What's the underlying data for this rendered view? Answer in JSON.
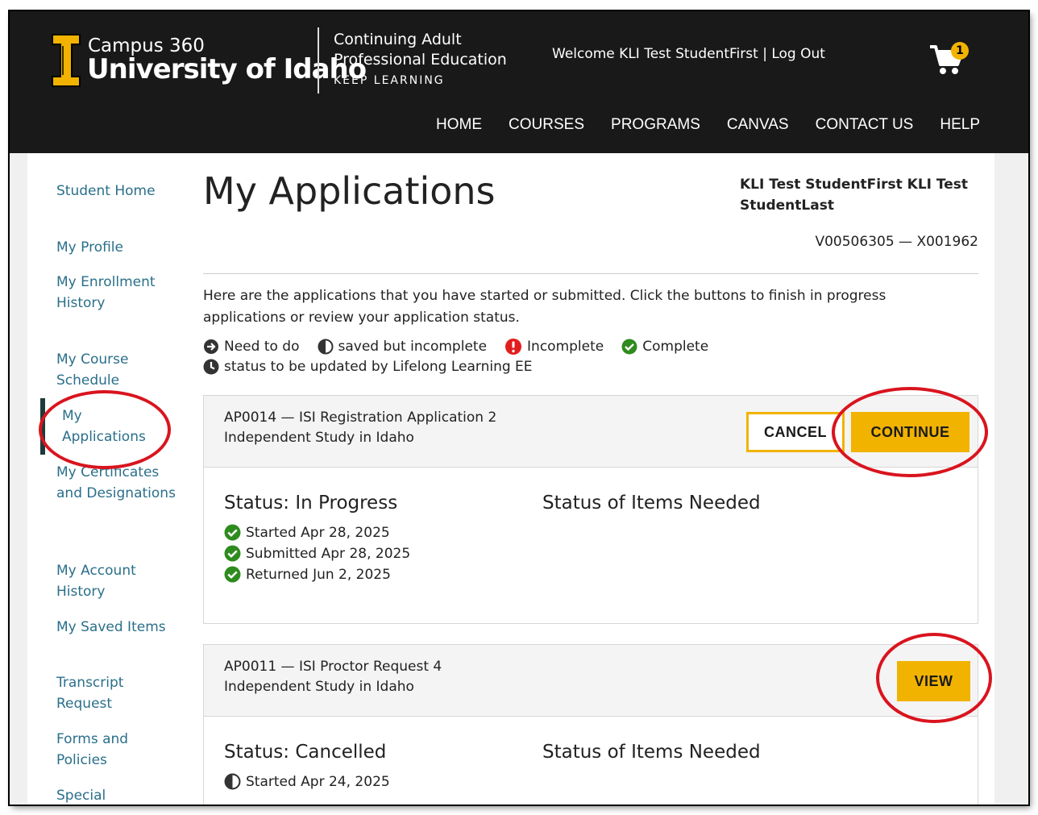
{
  "header": {
    "logo_campus": "Campus 360",
    "logo_university": "University of Idaho",
    "cape_line1": "Continuing Adult",
    "cape_line2": "Professional Education",
    "cape_line3": "KEEP LEARNING",
    "welcome": "Welcome KLI Test StudentFirst",
    "separator": "|",
    "logout": "Log Out",
    "cart_count": "1",
    "cart_icon": "shopping-cart-icon"
  },
  "nav": [
    "HOME",
    "COURSES",
    "PROGRAMS",
    "CANVAS",
    "CONTACT US",
    "HELP"
  ],
  "sidebar": {
    "items": [
      "Student Home",
      "My Profile",
      "My Enrollment History",
      "My Course Schedule",
      "My Applications",
      "My Certificates and Designations",
      "My Account History",
      "My Saved Items",
      "Transcript Request",
      "Forms and Policies",
      "Special"
    ],
    "active_index": 4
  },
  "main": {
    "title": "My Applications",
    "student_name": "KLI Test StudentFirst KLI Test StudentLast",
    "student_ids": "V00506305 — X001962",
    "intro": "Here are the applications that you have started or submitted. Click the buttons to finish in progress applications or review your application status.",
    "legend": {
      "need_to_do": "Need to do",
      "saved": "saved but incomplete",
      "incomplete": "Incomplete",
      "complete": "Complete",
      "status_updated": "status to be updated by Lifelong Learning EE"
    }
  },
  "applications": [
    {
      "title": "AP0014 — ISI Registration Application 2",
      "subtitle": "Independent Study in Idaho",
      "buttons": {
        "cancel": "CANCEL",
        "continue": "CONTINUE"
      },
      "status": "Status: In Progress",
      "items_needed": "Status of Items Needed",
      "history": [
        "Started Apr 28, 2025",
        "Submitted Apr 28, 2025",
        "Returned Jun 2, 2025"
      ]
    },
    {
      "title": "AP0011 — ISI Proctor Request 4",
      "subtitle": "Independent Study in Idaho",
      "buttons": {
        "view": "VIEW"
      },
      "status": "Status: Cancelled",
      "items_needed": "Status of Items Needed",
      "history": [
        "Started Apr 24, 2025"
      ]
    }
  ],
  "colors": {
    "header_bg": "#191919",
    "accent_gold": "#f1b300",
    "link": "#2a6f8a",
    "complete_green": "#2e8b1e",
    "incomplete_red": "#e21d1d",
    "annotation_red": "#d9141e"
  }
}
